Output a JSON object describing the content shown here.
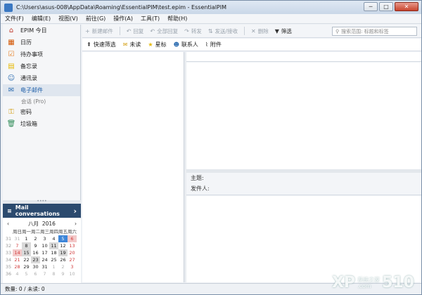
{
  "window": {
    "title": "C:\\Users\\asus-008\\AppData\\Roaming\\EssentialPIM\\test.epim - EssentialPIM",
    "minimize_glyph": "─",
    "maximize_glyph": "□",
    "close_glyph": "✕"
  },
  "menu": [
    "文件(F)",
    "编辑(E)",
    "视图(V)",
    "前往(G)",
    "操作(A)",
    "工具(T)",
    "帮助(H)"
  ],
  "sidebar": {
    "items": [
      {
        "label": "EPIM 今日",
        "icon": "home-icon",
        "glyph": "⌂"
      },
      {
        "label": "日历",
        "icon": "calendar-icon",
        "glyph": "▦"
      },
      {
        "label": "待办事项",
        "icon": "todo-icon",
        "glyph": "☑"
      },
      {
        "label": "备忘录",
        "icon": "notes-icon",
        "glyph": "▤"
      },
      {
        "label": "通讯录",
        "icon": "contacts-icon",
        "glyph": "☺"
      },
      {
        "label": "电子邮件",
        "icon": "mail-icon",
        "glyph": "✉"
      },
      {
        "label": "密码",
        "icon": "key-icon",
        "glyph": "⚿"
      },
      {
        "label": "垃圾箱",
        "icon": "trash-icon",
        "glyph": "🗑"
      }
    ],
    "sub_item": "会话 (Pro)",
    "splitter_glyph": "••••",
    "mail_panel": {
      "label": "Mail conversations",
      "glyph": "≡",
      "arrow": "›"
    }
  },
  "calendar": {
    "month": "八月",
    "year": "2016",
    "prev_glyph": "‹",
    "next_glyph": "›",
    "dow": [
      "周日",
      "周一",
      "周二",
      "周三",
      "周四",
      "周五",
      "周六"
    ],
    "rows": [
      {
        "week": "31",
        "days": [
          "31",
          "1",
          "2",
          "3",
          "4",
          "5",
          "6"
        ]
      },
      {
        "week": "32",
        "days": [
          "7",
          "8",
          "9",
          "10",
          "11",
          "12",
          "13"
        ]
      },
      {
        "week": "33",
        "days": [
          "14",
          "15",
          "16",
          "17",
          "18",
          "19",
          "20"
        ]
      },
      {
        "week": "34",
        "days": [
          "21",
          "22",
          "23",
          "24",
          "25",
          "26",
          "27"
        ]
      },
      {
        "week": "35",
        "days": [
          "28",
          "29",
          "30",
          "31",
          "1",
          "2",
          "3"
        ]
      },
      {
        "week": "36",
        "days": [
          "4",
          "5",
          "6",
          "7",
          "8",
          "9",
          "10"
        ]
      }
    ],
    "today": "5"
  },
  "toolbar": {
    "new_mail": "新建邮件",
    "reply": "回复",
    "reply_all": "全部回复",
    "forward": "转发",
    "send_receive": "发送/接收",
    "delete": "删除",
    "filter": "筛选",
    "search_placeholder": "搜索范围: 标题和标签",
    "new_mail_glyph": "+",
    "reply_glyph": "↶",
    "reply_all_glyph": "↶",
    "forward_glyph": "↷",
    "send_receive_glyph": "⇅",
    "delete_glyph": "✕",
    "filter_glyph": "▼",
    "search_glyph": "⚲"
  },
  "filters": {
    "quick_filter": "快速筛选",
    "unread": "未读",
    "starred": "星标",
    "contact": "联系人",
    "attachment": "附件",
    "quick_filter_glyph": "⇞",
    "unread_glyph": "✉",
    "starred_glyph": "★",
    "contact_glyph": "☻",
    "attachment_glyph": "⌇"
  },
  "message": {
    "subject_label": "主题:",
    "from_label": "发件人:"
  },
  "status": {
    "text": "数量: 0 / 未读: 0"
  },
  "watermark": {
    "mark": "XP",
    "number": "510",
    "suffix": ".com",
    "tagline": "系统之家"
  }
}
